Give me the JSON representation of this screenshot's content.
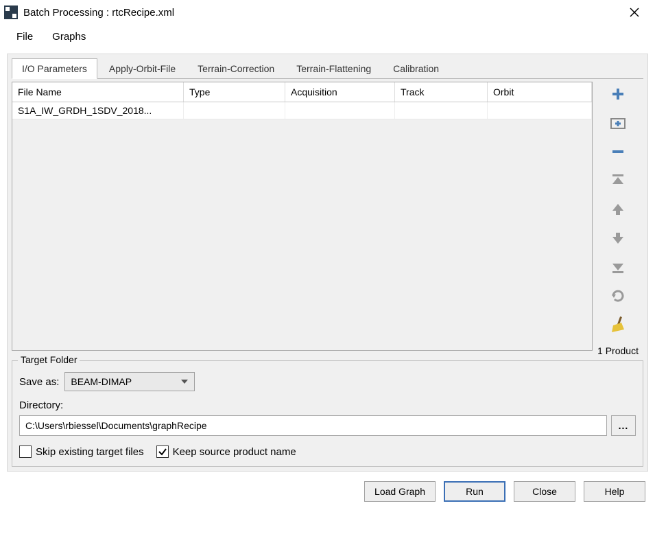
{
  "window": {
    "title": "Batch Processing : rtcRecipe.xml"
  },
  "menu": {
    "file": "File",
    "graphs": "Graphs"
  },
  "tabs": [
    {
      "label": "I/O Parameters"
    },
    {
      "label": "Apply-Orbit-File"
    },
    {
      "label": "Terrain-Correction"
    },
    {
      "label": "Terrain-Flattening"
    },
    {
      "label": "Calibration"
    }
  ],
  "table": {
    "headers": {
      "filename": "File Name",
      "type": "Type",
      "acquisition": "Acquisition",
      "track": "Track",
      "orbit": "Orbit"
    },
    "rows": [
      {
        "filename": "S1A_IW_GRDH_1SDV_2018...",
        "type": "",
        "acquisition": "",
        "track": "",
        "orbit": ""
      }
    ]
  },
  "product_count_label": "1 Product",
  "target": {
    "legend": "Target Folder",
    "save_as_label": "Save as:",
    "save_as_value": "BEAM-DIMAP",
    "directory_label": "Directory:",
    "directory_value": "C:\\Users\\rbiessel\\Documents\\graphRecipe",
    "browse_label": "...",
    "skip_label": "Skip existing target files",
    "skip_checked": false,
    "keep_label": "Keep source product name",
    "keep_checked": true
  },
  "buttons": {
    "load": "Load Graph",
    "run": "Run",
    "close": "Close",
    "help": "Help"
  }
}
